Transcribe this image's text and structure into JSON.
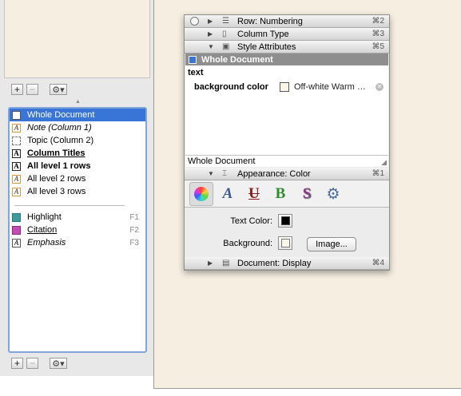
{
  "sidebar": {
    "top_buttons": {
      "add": "+",
      "remove": "−",
      "actions": "⚙▾"
    },
    "bottom_buttons": {
      "add": "+",
      "remove": "−",
      "actions": "⚙▾"
    },
    "styles": [
      {
        "label": "Whole Document",
        "icon": "plain-box-icon",
        "selected": true
      },
      {
        "label": "Note (Column 1)",
        "icon": "a-style-icon",
        "italic": true
      },
      {
        "label": "Topic (Column 2)",
        "icon": "dashed-box-icon"
      },
      {
        "label": "Column Titles",
        "icon": "bold-a-icon",
        "bold": true,
        "underline": true
      },
      {
        "label": "All level 1 rows",
        "icon": "bold-a-icon",
        "bold": true
      },
      {
        "label": "All level 2 rows",
        "icon": "a-style-icon"
      },
      {
        "label": "All level 3 rows",
        "icon": "a-style-icon"
      }
    ],
    "named_styles": [
      {
        "label": "Highlight",
        "icon": "teal-swatch-icon",
        "shortcut": "F1"
      },
      {
        "label": "Citation",
        "icon": "purple-swatch-icon",
        "shortcut": "F2",
        "underline": true
      },
      {
        "label": "Emphasis",
        "icon": "a-style-icon",
        "shortcut": "F3",
        "italic": true
      }
    ]
  },
  "inspector": {
    "sections": {
      "row_numbering": {
        "title": "Row: Numbering",
        "shortcut": "⌘2"
      },
      "column_type": {
        "title": "Column Type",
        "shortcut": "⌘3"
      },
      "style_attributes": {
        "title": "Style Attributes",
        "shortcut": "⌘5"
      },
      "appearance_color": {
        "title": "Appearance: Color",
        "shortcut": "⌘1"
      },
      "document_display": {
        "title": "Document: Display",
        "shortcut": "⌘4"
      }
    },
    "style_header": "Whole Document",
    "attributes": {
      "group": "text",
      "name": "background color",
      "value": "Off-white Warm …"
    },
    "style_footer": "Whole Document",
    "tabs": [
      "color-wheel-icon",
      "font-icon",
      "underline-strike-icon",
      "bold-icon",
      "shadow-s-icon",
      "gear-icon"
    ],
    "tab_glyphs": {
      "font": "A",
      "underline": "U",
      "bold": "B",
      "shadow": "S",
      "gear": "⚙"
    },
    "color": {
      "text_color_label": "Text Color:",
      "background_label": "Background:",
      "image_button": "Image...",
      "text_color_value": "#000000",
      "background_value": "#fbf6e8"
    }
  },
  "colors": {
    "document_bg": "#f6efe1",
    "selection": "#3875d7",
    "list_border": "#7ea6d8"
  }
}
